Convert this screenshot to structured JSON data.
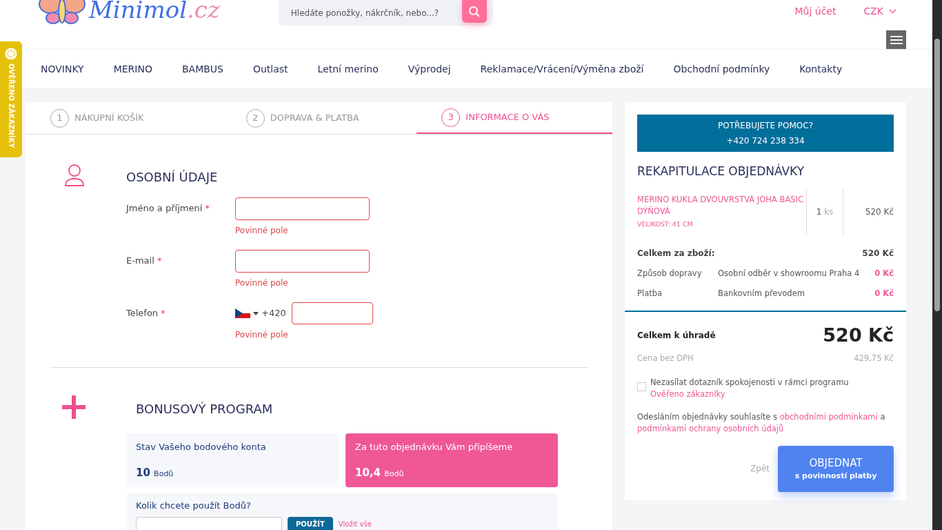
{
  "header": {
    "logo": {
      "name": "Minimol",
      "domain": ".cz"
    },
    "search": {
      "placeholder": "Hledáte ponožky, nákrčník, nebo...?"
    },
    "account": "Můj účet",
    "currency": "CZK"
  },
  "side_badge": "OVĚŘENO ZÁKAZNÍKY",
  "nav": [
    "NOVINKY",
    "MERINO",
    "BAMBUS",
    "Outlast",
    "Letní merino",
    "Výprodej",
    "Reklamace/Vrácení/Výměna zboží",
    "Obchodní podmínky",
    "Kontakty"
  ],
  "steps": [
    {
      "number": "1",
      "label": "NÁKUPNÍ KOŠÍK",
      "selected": false
    },
    {
      "number": "2",
      "label": "DOPRAVA & PLATBA",
      "selected": false
    },
    {
      "number": "3",
      "label": "INFORMACE O VÁS",
      "selected": true
    }
  ],
  "personal": {
    "title": "OSOBNÍ ÚDAJE",
    "fields": [
      {
        "kind": "text",
        "label": "Jméno a příjmení",
        "required_mark": "*",
        "error": "Povinné pole"
      },
      {
        "kind": "text",
        "label": "E-mail",
        "required_mark": "*",
        "error": "Povinné pole"
      },
      {
        "kind": "phone",
        "label": "Telefon",
        "required_mark": "*",
        "prefix": "+420",
        "error": "Povinné pole"
      }
    ]
  },
  "bonus": {
    "title": "BONUSOVÝ PROGRAM",
    "cards": [
      {
        "kind": "balance",
        "label": "Stav Vašeho bodového konta",
        "value": "10",
        "unit": "Bodů"
      },
      {
        "kind": "earn",
        "label": "Za tuto objednávku Vám připíšeme",
        "value": "10,4",
        "unit": "Bodů"
      }
    ],
    "use_label": "Kolik chcete použít Bodů?",
    "apply_button": "POUŽÍT",
    "all_link": "Vložit vše"
  },
  "summary": {
    "help": {
      "title": "POTŘEBUJETE POMOC?",
      "phone": "+420 724 238 334"
    },
    "title": "REKAPITULACE OBJEDNÁVKY",
    "items": [
      {
        "name": "MERINO KUKLA DVOUVRSTVÁ JOHA BASIC DÝŇOVÁ",
        "variant": "VELIKOST: 41 CM",
        "qty": "1",
        "unit": "ks",
        "price": "520 Kč"
      }
    ],
    "goods_total": {
      "label": "Celkem za zboží:",
      "value": "520 Kč"
    },
    "lines": [
      {
        "label": "Způsob dopravy",
        "detail": "Osobní odběr v showroomu Praha 4",
        "value": "0 Kč"
      },
      {
        "label": "Platba",
        "detail": "Bankovním převodem",
        "value": "0 Kč"
      }
    ],
    "total": {
      "label": "Celkem k úhradě",
      "value": "520 Kč"
    },
    "net": {
      "label": "Cena bez DPH",
      "value": "429,75 Kč"
    },
    "survey_opt_out": {
      "checked": false,
      "text": "Nezasílat dotazník spokojenosti v rámci programu",
      "link": "Ověřeno zákazníky"
    },
    "terms": {
      "before": "Odesláním objednávky souhlasíte s",
      "link1": "obchodními podmínkami",
      "middle": "a",
      "link2": "podmínkami ochrany osobních údajů"
    },
    "back": "Zpět",
    "submit": {
      "title": "OBJEDNAT",
      "subtitle": "s povinností platby"
    }
  }
}
